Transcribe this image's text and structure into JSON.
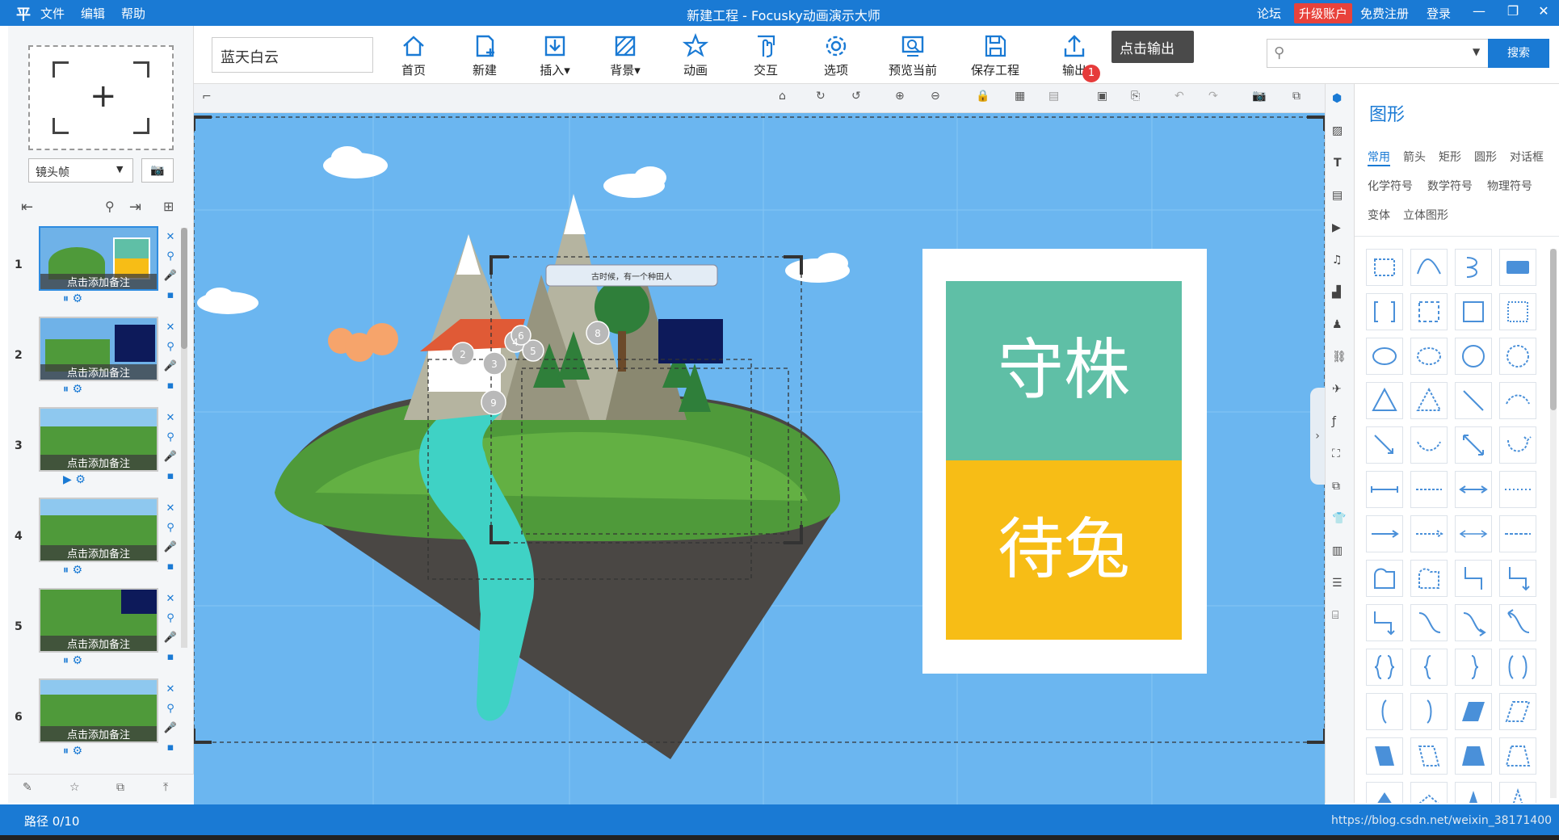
{
  "titlebar": {
    "menu": [
      "文件",
      "编辑",
      "帮助"
    ],
    "title": "新建工程 - Focusky动画演示大师",
    "links": [
      "论坛",
      "升级账户",
      "免费注册",
      "登录"
    ]
  },
  "toolbar": {
    "project_name": "蓝天白云",
    "buttons": [
      {
        "label": "首页",
        "icon": "home-icon"
      },
      {
        "label": "新建",
        "icon": "new-icon"
      },
      {
        "label": "插入▾",
        "icon": "insert-icon"
      },
      {
        "label": "背景▾",
        "icon": "background-icon"
      },
      {
        "label": "动画",
        "icon": "animation-icon"
      },
      {
        "label": "交互",
        "icon": "interaction-icon"
      },
      {
        "label": "选项",
        "icon": "settings-icon"
      },
      {
        "label": "预览当前",
        "icon": "preview-icon"
      },
      {
        "label": "保存工程",
        "icon": "save-icon"
      },
      {
        "label": "输出",
        "icon": "export-icon"
      }
    ],
    "tooltip": "点击输出",
    "badge": "1",
    "search_placeholder": "",
    "search_button": "搜索"
  },
  "left_panel": {
    "frame_type": "镜头帧",
    "slides": [
      {
        "num": "1",
        "note": "点击添加备注"
      },
      {
        "num": "2",
        "note": "点击添加备注"
      },
      {
        "num": "3",
        "note": "点击添加备注"
      },
      {
        "num": "4",
        "note": "点击添加备注"
      },
      {
        "num": "5",
        "note": "点击添加备注"
      },
      {
        "num": "6",
        "note": "点击添加备注"
      }
    ]
  },
  "canvas": {
    "card_top": "守株",
    "card_bottom": "待兔",
    "scroll_caption": "古时候，有一个种田人",
    "path_markers": [
      "2",
      "3",
      "4",
      "5",
      "6",
      "8",
      "9"
    ],
    "colors": {
      "sky": "#6bb6f0",
      "card_top": "#5fbfa6",
      "card_bottom": "#f7bd16"
    }
  },
  "shape_panel": {
    "title": "图形",
    "tabs": [
      "常用",
      "箭头",
      "矩形",
      "圆形",
      "对话框",
      "化学符号",
      "数学符号",
      "物理符号",
      "变体",
      "立体图形"
    ]
  },
  "status": {
    "path": "路径 0/10",
    "watermark": "https://blog.csdn.net/weixin_38171400"
  }
}
